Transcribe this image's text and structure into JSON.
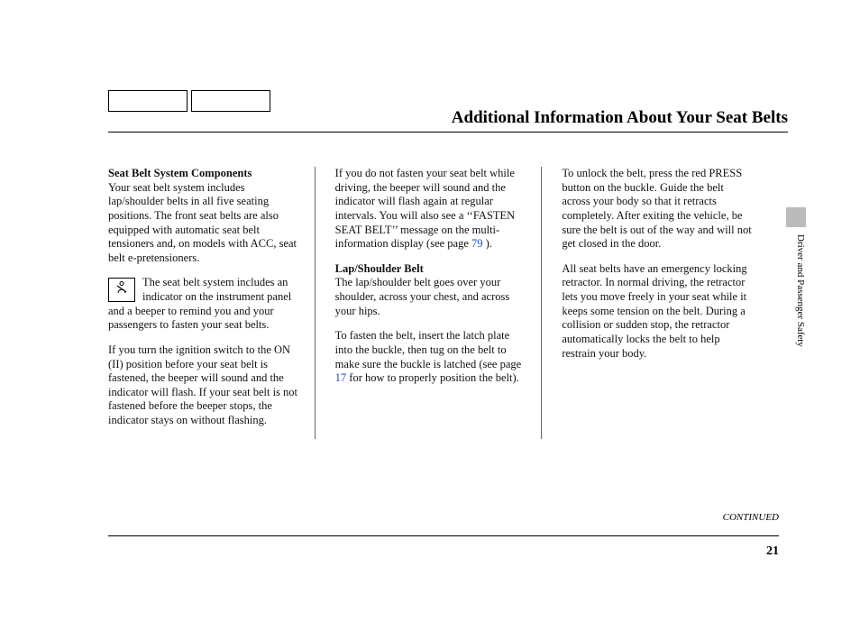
{
  "title": "Additional Information About Your Seat Belts",
  "side_label": "Driver and Passenger Safety",
  "continued": "CONTINUED",
  "page_number": "21",
  "col1": {
    "h1": "Seat Belt System Components",
    "p1": "Your seat belt system includes lap/shoulder belts in all five seating positions. The front seat belts are also equipped with automatic seat belt tensioners and, on models with ACC, seat belt e-pretensioners.",
    "p2a": "The seat belt system includes an indicator on the instrument panel and a beeper to remind you and your passengers to fasten your seat belts.",
    "p3": "If you turn the ignition switch to the ON (II) position before your seat belt is fastened, the beeper will sound and the indicator will flash. If your seat belt is not fastened before the beeper stops, the indicator stays on without flashing."
  },
  "col2": {
    "p1a": "If you do not fasten your seat belt while driving, the beeper will sound and the indicator will flash again at regular intervals. You will also see a ‘‘FASTEN SEAT BELT’’ message on the multi-information display (see page ",
    "link1": "79",
    "p1b": " ).",
    "h2": "Lap/Shoulder Belt",
    "p2": "The lap/shoulder belt goes over your shoulder, across your chest, and across your hips.",
    "p3a": "To fasten the belt, insert the latch plate into the buckle, then tug on the belt to make sure the buckle is latched (see page ",
    "link2": "17",
    "p3b": " for how to properly position the belt)."
  },
  "col3": {
    "p1": "To unlock the belt, press the red PRESS button on the buckle. Guide the belt across your body so that it retracts completely. After exiting the vehicle, be sure the belt is out of the way and will not get closed in the door.",
    "p2": "All seat belts have an emergency locking retractor. In normal driving, the retractor lets you move freely in your seat while it keeps some tension on the belt. During a collision or sudden stop, the retractor automatically locks the belt to help restrain your body."
  }
}
